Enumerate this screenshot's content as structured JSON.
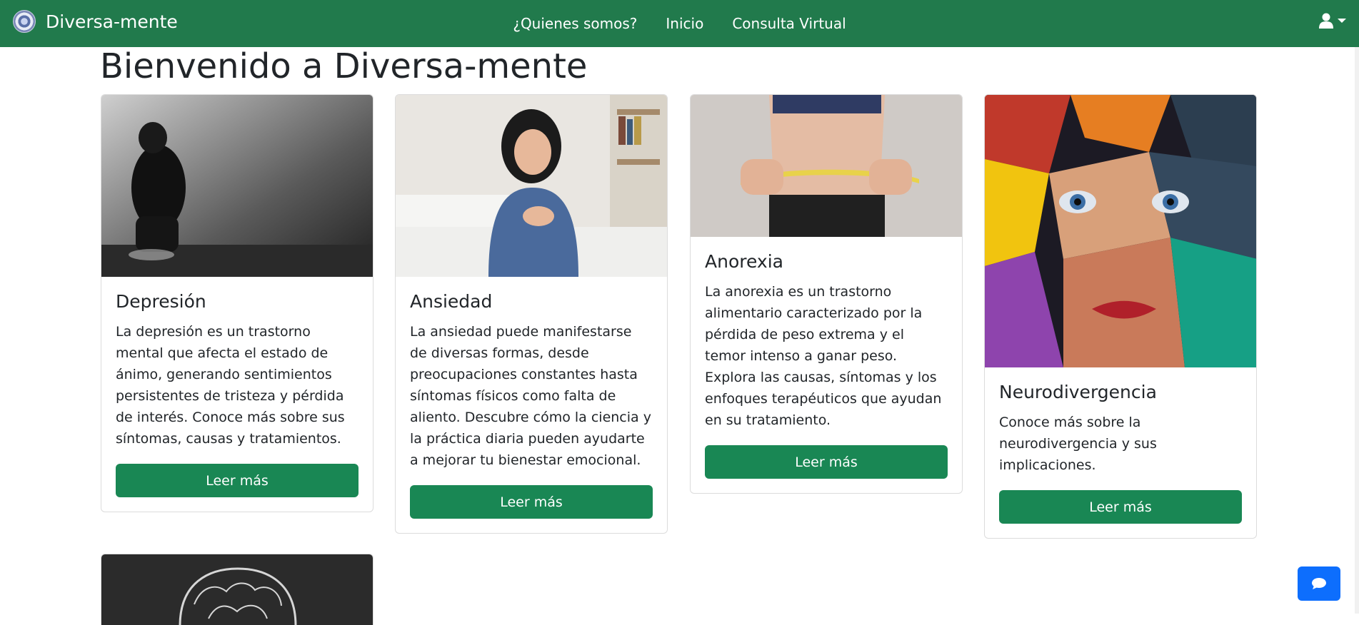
{
  "navbar": {
    "brand": "Diversa-mente",
    "links": [
      "¿Quienes somos?",
      "Inicio",
      "Consulta Virtual"
    ],
    "bg_color": "#217a4c"
  },
  "main": {
    "title": "Bienvenido a Diversa-mente",
    "cards": [
      {
        "title": "Depresión",
        "text": "La depresión es un trastorno mental que afecta el estado de ánimo, generando sentimientos persistentes de tristeza y pérdida de interés. Conoce más sobre sus síntomas, causas y tratamientos.",
        "button": "Leer más"
      },
      {
        "title": "Ansiedad",
        "text": "La ansiedad puede manifestarse de diversas formas, desde preocupaciones constantes hasta síntomas físicos como falta de aliento. Descubre cómo la ciencia y la práctica diaria pueden ayudarte a mejorar tu bienestar emocional.",
        "button": "Leer más"
      },
      {
        "title": "Anorexia",
        "text": "La anorexia es un trastorno alimentario caracterizado por la pérdida de peso extrema y el temor intenso a ganar peso. Explora las causas, síntomas y los enfoques terapéuticos que ayudan en su tratamiento.",
        "button": "Leer más"
      },
      {
        "title": "Neurodivergencia",
        "text": "Conoce más sobre la neurodivergencia y sus implicaciones.",
        "button": "Leer más"
      }
    ]
  },
  "icons": {
    "user": "user-icon",
    "caret": "caret-down-icon",
    "chat": "chat-icon"
  },
  "colors": {
    "button": "#198754",
    "chat_button": "#0d6efd"
  }
}
